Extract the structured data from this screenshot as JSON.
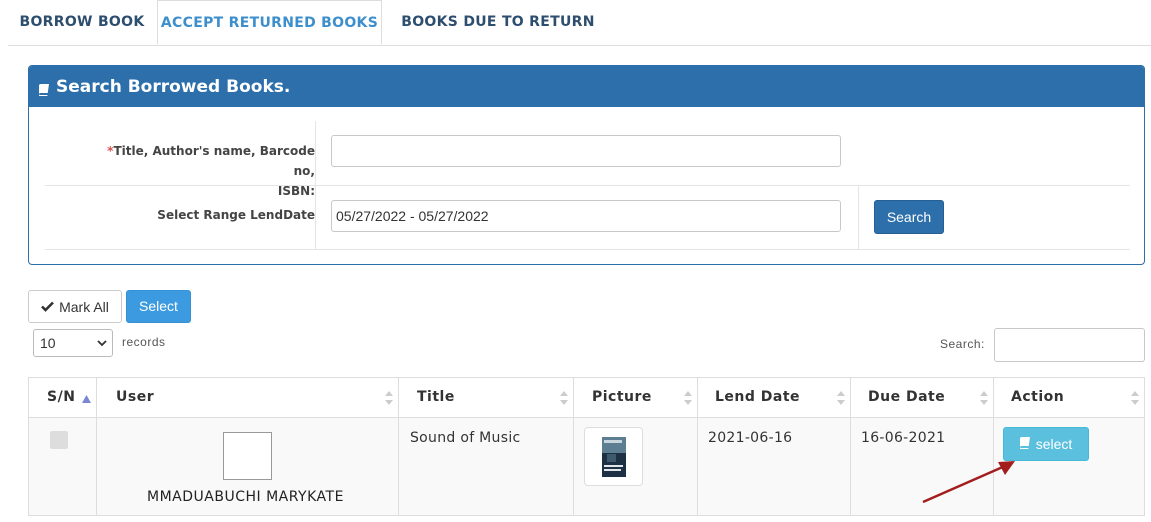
{
  "tabs": [
    {
      "label": "BORROW BOOK"
    },
    {
      "label": "ACCEPT RETURNED BOOKS",
      "active": true
    },
    {
      "label": "BOOKS DUE TO RETURN"
    }
  ],
  "search_panel": {
    "title": "Search Borrowed Books.",
    "query_label_required": "*",
    "query_label_line1": "Title, Author's name, Barcode no,",
    "query_label_line2": "ISBN:",
    "query_value": "",
    "range_label": "Select Range LendDate",
    "range_value": "05/27/2022 - 05/27/2022",
    "search_button": "Search"
  },
  "controls": {
    "mark_all": "Mark All",
    "select": "Select",
    "page_length": "10",
    "records": "records",
    "search_label": "Search:",
    "search_value": ""
  },
  "table": {
    "columns": [
      "S/N",
      "User",
      "Title",
      "Picture",
      "Lend Date",
      "Due Date",
      "Action"
    ],
    "rows": [
      {
        "user": "MMADUABUCHI MARYKATE",
        "title": "Sound of Music",
        "lend_date": "2021-06-16",
        "due_date": "16-06-2021",
        "action": "select"
      }
    ]
  },
  "colors": {
    "panel": "#2c6fab",
    "active_tab": "#3d8fcc",
    "select_button": "#3c9be0",
    "action_button": "#5bc0de",
    "arrow": "#a31d1d"
  },
  "icons": [
    "book-icon",
    "check-icon",
    "sort-icon",
    "chevron-down-icon",
    "arrow-annotation"
  ]
}
